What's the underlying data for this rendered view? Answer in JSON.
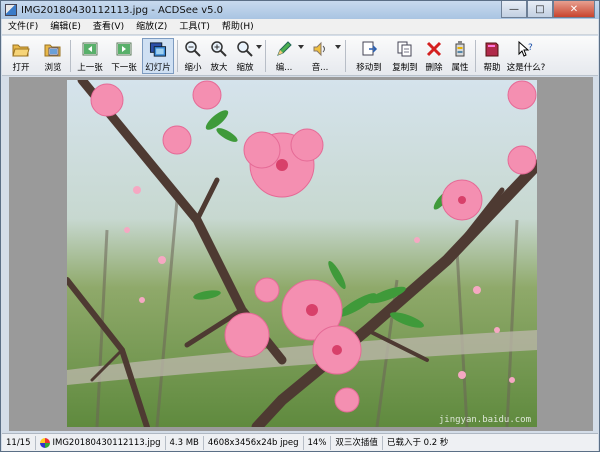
{
  "window": {
    "title": "IMG20180430112113.jpg - ACDSee v5.0",
    "minimize_icon": "minimize-icon",
    "maximize_icon": "maximize-icon",
    "close_icon": "close-icon"
  },
  "menu": [
    {
      "label": "文件(F)"
    },
    {
      "label": "编辑(E)"
    },
    {
      "label": "查看(V)"
    },
    {
      "label": "缩放(Z)"
    },
    {
      "label": "工具(T)"
    },
    {
      "label": "帮助(H)"
    }
  ],
  "toolbar": {
    "open": {
      "label": "打开",
      "icon": "folder-open-icon"
    },
    "browse": {
      "label": "浏览",
      "icon": "browse-folder-icon"
    },
    "prev": {
      "label": "上一张",
      "icon": "prev-image-icon"
    },
    "next": {
      "label": "下一张",
      "icon": "next-image-icon"
    },
    "slideshow": {
      "label": "幻灯片",
      "icon": "slideshow-icon"
    },
    "zoom_out": {
      "label": "缩小",
      "icon": "zoom-out-icon"
    },
    "zoom_in": {
      "label": "放大",
      "icon": "zoom-in-icon"
    },
    "zoom": {
      "label": "缩放",
      "icon": "zoom-icon"
    },
    "edit": {
      "label": "编...",
      "icon": "edit-icon"
    },
    "audio": {
      "label": "音...",
      "icon": "audio-icon"
    },
    "move_to": {
      "label": "移动到",
      "icon": "move-to-icon"
    },
    "copy_to": {
      "label": "复制到",
      "icon": "copy-to-icon"
    },
    "delete": {
      "label": "删除",
      "icon": "delete-icon"
    },
    "properties": {
      "label": "属性",
      "icon": "properties-icon"
    },
    "help": {
      "label": "帮助",
      "icon": "help-book-icon"
    },
    "whats_this": {
      "label": "这是什么?",
      "icon": "whats-this-icon"
    }
  },
  "photo": {
    "watermark": "jingyan.baidu.com"
  },
  "status": {
    "index": "11/15",
    "filename": "IMG20180430112113.jpg",
    "size": "4.3 MB",
    "dimensions": "4608x3456x24b jpeg",
    "zoom": "14%",
    "interp": "双三次插值",
    "load_time": "已载入于 0.2 秒"
  },
  "colors": {
    "titlebar": "#a9c4e2",
    "close_button": "#c8442e",
    "viewer_background": "#9a9a9a",
    "blossom": "#f48fb1"
  }
}
